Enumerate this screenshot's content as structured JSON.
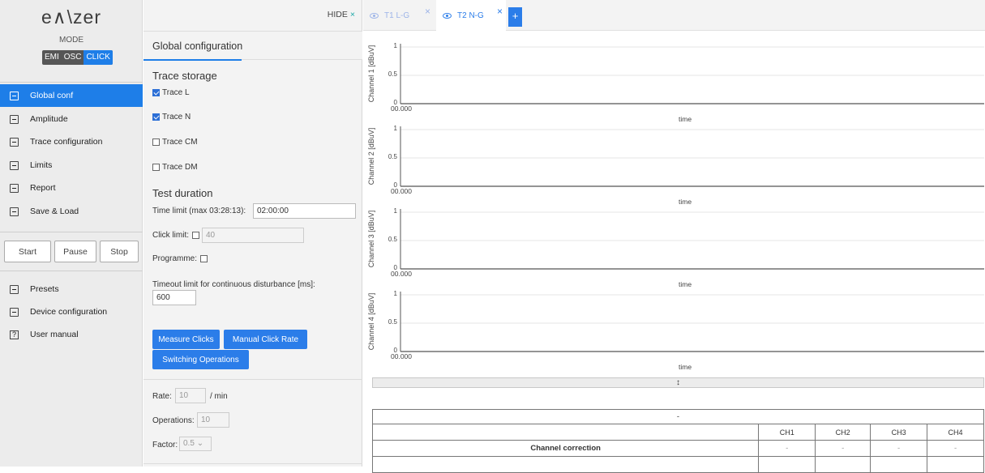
{
  "sidebar": {
    "logo": "e∧\\zer",
    "mode_label": "MODE",
    "modes": [
      {
        "label": "EMI",
        "active": false
      },
      {
        "label": "OSC",
        "active": false
      },
      {
        "label": "CLICK",
        "active": true
      }
    ],
    "nav": [
      {
        "label": "Global conf",
        "icon": "grid-icon",
        "active": true
      },
      {
        "label": "Amplitude",
        "icon": "waveform-icon",
        "active": false
      },
      {
        "label": "Trace configuration",
        "icon": "grid-icon",
        "active": false
      },
      {
        "label": "Limits",
        "icon": "square-icon",
        "active": false
      },
      {
        "label": "Report",
        "icon": "document-icon",
        "active": false
      },
      {
        "label": "Save & Load",
        "icon": "floppy-icon",
        "active": false
      }
    ],
    "controls": {
      "start": "Start",
      "pause": "Pause",
      "stop": "Stop"
    },
    "bottom_nav": [
      {
        "label": "Presets",
        "icon": "preset-icon"
      },
      {
        "label": "Device configuration",
        "icon": "gear-icon"
      },
      {
        "label": "User manual",
        "icon": "help-icon"
      }
    ],
    "help_glyph": "?"
  },
  "config": {
    "hide_label": "HIDE",
    "hide_x": "×",
    "panel_title": "Global configuration",
    "trace_storage_title": "Trace storage",
    "traces": [
      {
        "label": "Trace L",
        "checked": true
      },
      {
        "label": "Trace N",
        "checked": true
      },
      {
        "label": "Trace CM",
        "checked": false
      },
      {
        "label": "Trace DM",
        "checked": false
      }
    ],
    "test_duration_title": "Test duration",
    "time_limit_label": "Time limit (max 03:28:13):",
    "time_limit_value": "02:00:00",
    "click_limit_label": "Click limit:",
    "click_limit_value": "40",
    "programme_label": "Programme:",
    "timeout_label": "Timeout limit for continuous disturbance [ms]:",
    "timeout_value": "600",
    "buttons": {
      "measure_clicks": "Measure Clicks",
      "manual_click_rate": "Manual Click Rate",
      "switching_operations": "Switching Operations"
    },
    "rate_label": "Rate:",
    "rate_value": "10",
    "rate_unit": "/ min",
    "operations_label": "Operations:",
    "operations_value": "10",
    "factor_label": "Factor:",
    "factor_value": "0.5"
  },
  "tabs": [
    {
      "label": "T1 L-G",
      "active": false,
      "color": "#9db4e8"
    },
    {
      "label": "T2 N-G",
      "active": true,
      "color": "#2b7de9"
    }
  ],
  "tab_close_glyph": "×",
  "add_tab_glyph": "+",
  "charts": {
    "xlabel": "time",
    "yticks": [
      "1",
      "0.5",
      "0"
    ],
    "x_tick": "00.000",
    "channels": [
      {
        "ylabel": "Channel 1 [dBuV]"
      },
      {
        "ylabel": "Channel 2 [dBuV]"
      },
      {
        "ylabel": "Channel 3 [dBuV]"
      },
      {
        "ylabel": "Channel 4 [dBuV]"
      }
    ],
    "splitter_glyph": "↕"
  },
  "table": {
    "collapse_glyph": "-",
    "columns": [
      "CH1",
      "CH2",
      "CH3",
      "CH4"
    ],
    "rows": [
      {
        "label": "Channel correction",
        "values": [
          "-",
          "-",
          "-",
          "-"
        ]
      }
    ]
  },
  "colors": {
    "accent": "#1e7ee8",
    "teal": "#18a6a6"
  }
}
